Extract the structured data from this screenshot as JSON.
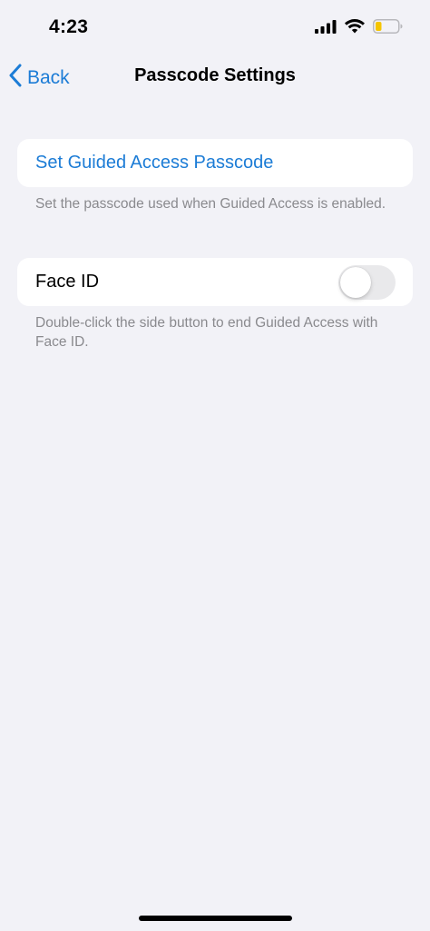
{
  "status_bar": {
    "time": "4:23",
    "battery_color": "#F5C500",
    "icons": [
      "signal-icon",
      "wifi-icon",
      "battery-icon"
    ]
  },
  "nav": {
    "back_label": "Back",
    "title": "Passcode Settings"
  },
  "groups": [
    {
      "row_label": "Set Guided Access Passcode",
      "footer": "Set the passcode used when Guided Access is enabled."
    },
    {
      "row_label": "Face ID",
      "toggle_on": false,
      "footer": "Double-click the side button to end Guided Access with Face ID."
    }
  ],
  "colors": {
    "accent": "#1C7CD6",
    "background": "#F2F2F7",
    "secondary_text": "#8A8A8E"
  }
}
